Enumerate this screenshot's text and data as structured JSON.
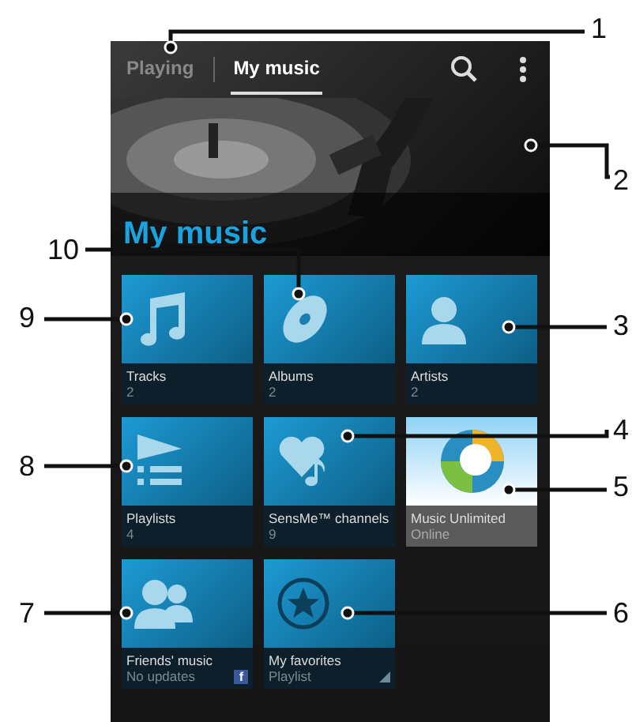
{
  "tabs": [
    {
      "label": "Playing",
      "selected": false
    },
    {
      "label": "My music",
      "selected": true
    }
  ],
  "heading": "My music",
  "tiles": [
    {
      "kind": "note",
      "title": "Tracks",
      "subtitle": "2"
    },
    {
      "kind": "disc",
      "title": "Albums",
      "subtitle": "2"
    },
    {
      "kind": "person",
      "title": "Artists",
      "subtitle": "2"
    },
    {
      "kind": "playlist",
      "title": "Playlists",
      "subtitle": "4"
    },
    {
      "kind": "heartnote",
      "title": "SensMe™ channels",
      "subtitle": "9"
    },
    {
      "kind": "sphere",
      "title": "Music Unlimited",
      "subtitle": "Online"
    },
    {
      "kind": "people",
      "title": "Friends' music",
      "subtitle": "No updates",
      "badge": "f"
    },
    {
      "kind": "star",
      "title": "My favorites",
      "subtitle": "Playlist",
      "corner": true
    }
  ],
  "callouts": [
    {
      "number": "1"
    },
    {
      "number": "2"
    },
    {
      "number": "10"
    },
    {
      "number": "9"
    },
    {
      "number": "3"
    },
    {
      "number": "4"
    },
    {
      "number": "8"
    },
    {
      "number": "5"
    },
    {
      "number": "7"
    },
    {
      "number": "6"
    }
  ]
}
